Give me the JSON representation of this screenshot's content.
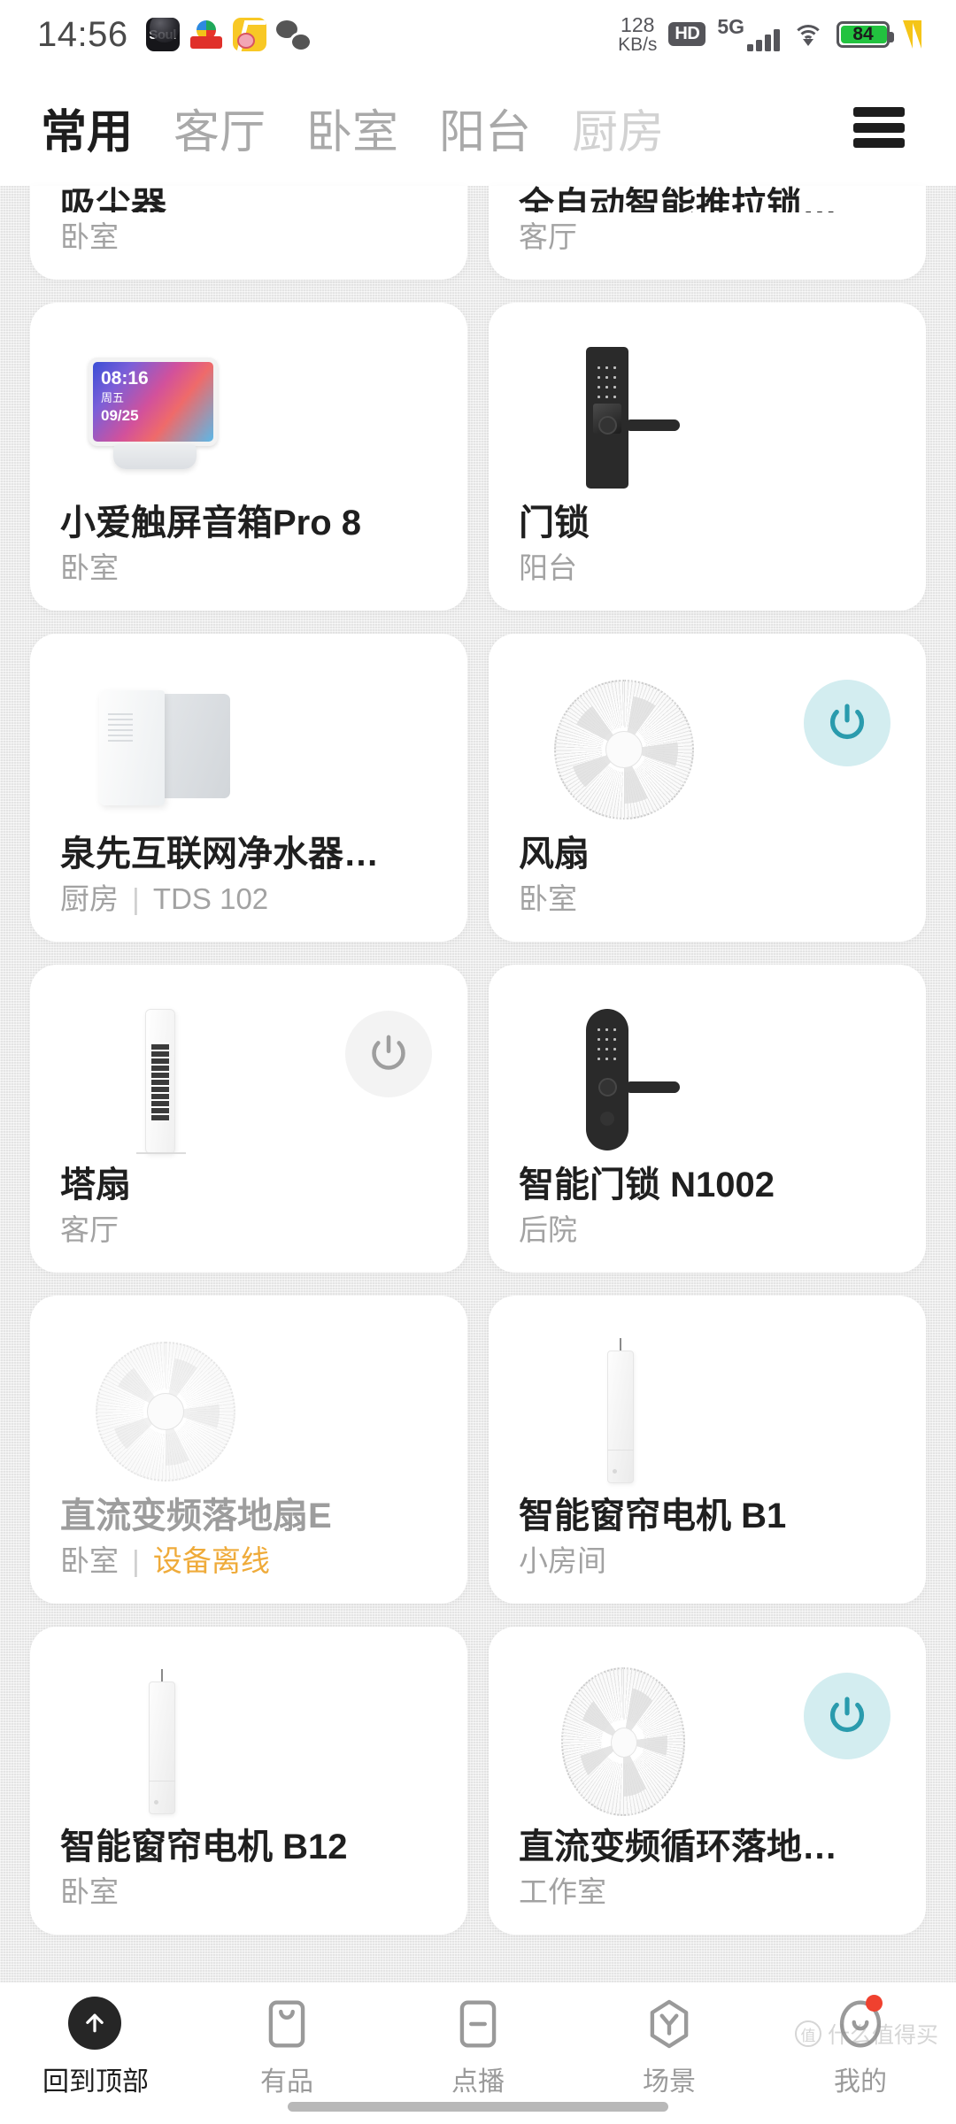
{
  "status_bar": {
    "time": "14:56",
    "app_icons": [
      "soul-app-icon",
      "red-app-icon",
      "yellow-app-icon",
      "wechat-app-icon"
    ],
    "network_speed_value": "128",
    "network_speed_unit": "KB/s",
    "hd_badge": "HD",
    "network_type": "5G",
    "signal_bars": 4,
    "wifi": "wifi-icon",
    "battery_level": "84",
    "battery_color": "#22c33f",
    "charging_icon": "lightning-bolt-icon"
  },
  "header": {
    "tabs": [
      {
        "label": "常用",
        "state": "active"
      },
      {
        "label": "客厅",
        "state": "inactive"
      },
      {
        "label": "卧室",
        "state": "inactive"
      },
      {
        "label": "阳台",
        "state": "inactive"
      },
      {
        "label": "厨房",
        "state": "faded"
      }
    ],
    "menu_icon": "hamburger-menu-icon"
  },
  "devices": [
    {
      "name": "吸尘器",
      "room": "卧室",
      "art": "vacuum",
      "clipped": true,
      "power": "none",
      "offline": false
    },
    {
      "name": "全自动智能推拉锁…",
      "room": "客厅",
      "art": "lock",
      "clipped": true,
      "power": "none",
      "offline": false
    },
    {
      "name": "小爱触屏音箱Pro 8",
      "room": "卧室",
      "art": "smart-display",
      "clipped": false,
      "power": "none",
      "offline": false,
      "screen": {
        "time": "08:16",
        "weekday": "周五",
        "date": "09/25"
      }
    },
    {
      "name": "门锁",
      "room": "阳台",
      "art": "door-lock",
      "clipped": false,
      "power": "none",
      "offline": false
    },
    {
      "name": "泉先互联网净水器…",
      "room": "厨房",
      "extra": "TDS 102",
      "art": "water-purifier",
      "clipped": false,
      "power": "none",
      "offline": false
    },
    {
      "name": "风扇",
      "room": "卧室",
      "art": "round-fan",
      "clipped": false,
      "power": "on",
      "offline": false
    },
    {
      "name": "塔扇",
      "room": "客厅",
      "art": "tower-fan",
      "clipped": false,
      "power": "off",
      "offline": false
    },
    {
      "name": "智能门锁 N1002",
      "room": "后院",
      "art": "door-lock-rounded",
      "clipped": false,
      "power": "none",
      "offline": false
    },
    {
      "name": "直流变频落地扇E",
      "room": "卧室",
      "extra": "设备离线",
      "art": "round-fan-pale",
      "clipped": false,
      "power": "none",
      "offline": true
    },
    {
      "name": "智能窗帘电机 B1",
      "room": "小房间",
      "art": "curtain-motor",
      "clipped": false,
      "power": "none",
      "offline": false
    },
    {
      "name": "智能窗帘电机 B12",
      "room": "卧室",
      "art": "curtain-motor",
      "clipped": false,
      "power": "none",
      "offline": false
    },
    {
      "name": "直流变频循环落地…",
      "room": "工作室",
      "art": "oval-fan",
      "clipped": false,
      "power": "on",
      "offline": false
    }
  ],
  "bottom_nav": [
    {
      "label": "回到顶部",
      "icon": "scroll-to-top-icon",
      "active": true,
      "badge": false
    },
    {
      "label": "有品",
      "icon": "youpin-bag-icon",
      "active": false,
      "badge": false
    },
    {
      "label": "点播",
      "icon": "ondemand-icon",
      "active": false,
      "badge": false
    },
    {
      "label": "场景",
      "icon": "scene-icon",
      "active": false,
      "badge": false
    },
    {
      "label": "我的",
      "icon": "profile-icon",
      "active": false,
      "badge": true
    }
  ],
  "watermark": {
    "mark": "值",
    "text": "什么值得买"
  },
  "colors": {
    "power_on_bg": "#d3edf0",
    "power_on_icon": "#2a9bad",
    "power_off_bg": "#f3f3f3",
    "power_off_icon": "#9e9e9e",
    "offline_text": "#efab3a",
    "badge": "#f0412f",
    "active_tab": "#1d1d1d"
  }
}
